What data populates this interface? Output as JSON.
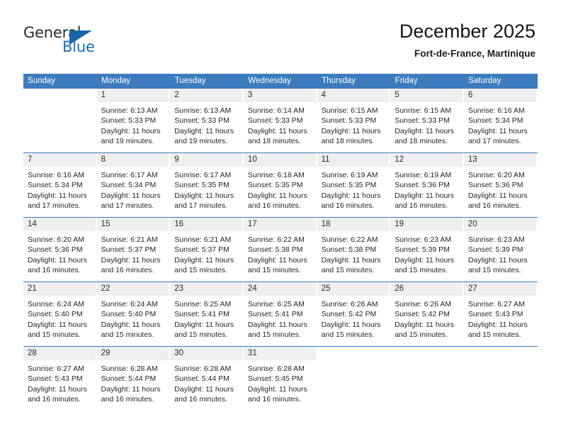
{
  "logo": {
    "word1": "General",
    "word2": "Blue",
    "triangle_color": "#1565a8",
    "blue_color": "#1c6fb8"
  },
  "header": {
    "title": "December 2025",
    "subtitle": "Fort-de-France, Martinique"
  },
  "theme": {
    "header_blue": "#3c7cbd",
    "daynum_gray": "#efefef",
    "text": "#262626"
  },
  "weekday_headers": [
    "Sunday",
    "Monday",
    "Tuesday",
    "Wednesday",
    "Thursday",
    "Friday",
    "Saturday"
  ],
  "weeks": [
    [
      {
        "day": "",
        "lines": []
      },
      {
        "day": "1",
        "lines": [
          "Sunrise: 6:13 AM",
          "Sunset: 5:33 PM",
          "Daylight: 11 hours",
          "and 19 minutes."
        ]
      },
      {
        "day": "2",
        "lines": [
          "Sunrise: 6:13 AM",
          "Sunset: 5:33 PM",
          "Daylight: 11 hours",
          "and 19 minutes."
        ]
      },
      {
        "day": "3",
        "lines": [
          "Sunrise: 6:14 AM",
          "Sunset: 5:33 PM",
          "Daylight: 11 hours",
          "and 18 minutes."
        ]
      },
      {
        "day": "4",
        "lines": [
          "Sunrise: 6:15 AM",
          "Sunset: 5:33 PM",
          "Daylight: 11 hours",
          "and 18 minutes."
        ]
      },
      {
        "day": "5",
        "lines": [
          "Sunrise: 6:15 AM",
          "Sunset: 5:33 PM",
          "Daylight: 11 hours",
          "and 18 minutes."
        ]
      },
      {
        "day": "6",
        "lines": [
          "Sunrise: 6:16 AM",
          "Sunset: 5:34 PM",
          "Daylight: 11 hours",
          "and 17 minutes."
        ]
      }
    ],
    [
      {
        "day": "7",
        "lines": [
          "Sunrise: 6:16 AM",
          "Sunset: 5:34 PM",
          "Daylight: 11 hours",
          "and 17 minutes."
        ]
      },
      {
        "day": "8",
        "lines": [
          "Sunrise: 6:17 AM",
          "Sunset: 5:34 PM",
          "Daylight: 11 hours",
          "and 17 minutes."
        ]
      },
      {
        "day": "9",
        "lines": [
          "Sunrise: 6:17 AM",
          "Sunset: 5:35 PM",
          "Daylight: 11 hours",
          "and 17 minutes."
        ]
      },
      {
        "day": "10",
        "lines": [
          "Sunrise: 6:18 AM",
          "Sunset: 5:35 PM",
          "Daylight: 11 hours",
          "and 16 minutes."
        ]
      },
      {
        "day": "11",
        "lines": [
          "Sunrise: 6:19 AM",
          "Sunset: 5:35 PM",
          "Daylight: 11 hours",
          "and 16 minutes."
        ]
      },
      {
        "day": "12",
        "lines": [
          "Sunrise: 6:19 AM",
          "Sunset: 5:36 PM",
          "Daylight: 11 hours",
          "and 16 minutes."
        ]
      },
      {
        "day": "13",
        "lines": [
          "Sunrise: 6:20 AM",
          "Sunset: 5:36 PM",
          "Daylight: 11 hours",
          "and 16 minutes."
        ]
      }
    ],
    [
      {
        "day": "14",
        "lines": [
          "Sunrise: 6:20 AM",
          "Sunset: 5:36 PM",
          "Daylight: 11 hours",
          "and 16 minutes."
        ]
      },
      {
        "day": "15",
        "lines": [
          "Sunrise: 6:21 AM",
          "Sunset: 5:37 PM",
          "Daylight: 11 hours",
          "and 16 minutes."
        ]
      },
      {
        "day": "16",
        "lines": [
          "Sunrise: 6:21 AM",
          "Sunset: 5:37 PM",
          "Daylight: 11 hours",
          "and 15 minutes."
        ]
      },
      {
        "day": "17",
        "lines": [
          "Sunrise: 6:22 AM",
          "Sunset: 5:38 PM",
          "Daylight: 11 hours",
          "and 15 minutes."
        ]
      },
      {
        "day": "18",
        "lines": [
          "Sunrise: 6:22 AM",
          "Sunset: 5:38 PM",
          "Daylight: 11 hours",
          "and 15 minutes."
        ]
      },
      {
        "day": "19",
        "lines": [
          "Sunrise: 6:23 AM",
          "Sunset: 5:39 PM",
          "Daylight: 11 hours",
          "and 15 minutes."
        ]
      },
      {
        "day": "20",
        "lines": [
          "Sunrise: 6:23 AM",
          "Sunset: 5:39 PM",
          "Daylight: 11 hours",
          "and 15 minutes."
        ]
      }
    ],
    [
      {
        "day": "21",
        "lines": [
          "Sunrise: 6:24 AM",
          "Sunset: 5:40 PM",
          "Daylight: 11 hours",
          "and 15 minutes."
        ]
      },
      {
        "day": "22",
        "lines": [
          "Sunrise: 6:24 AM",
          "Sunset: 5:40 PM",
          "Daylight: 11 hours",
          "and 15 minutes."
        ]
      },
      {
        "day": "23",
        "lines": [
          "Sunrise: 6:25 AM",
          "Sunset: 5:41 PM",
          "Daylight: 11 hours",
          "and 15 minutes."
        ]
      },
      {
        "day": "24",
        "lines": [
          "Sunrise: 6:25 AM",
          "Sunset: 5:41 PM",
          "Daylight: 11 hours",
          "and 15 minutes."
        ]
      },
      {
        "day": "25",
        "lines": [
          "Sunrise: 6:26 AM",
          "Sunset: 5:42 PM",
          "Daylight: 11 hours",
          "and 15 minutes."
        ]
      },
      {
        "day": "26",
        "lines": [
          "Sunrise: 6:26 AM",
          "Sunset: 5:42 PM",
          "Daylight: 11 hours",
          "and 15 minutes."
        ]
      },
      {
        "day": "27",
        "lines": [
          "Sunrise: 6:27 AM",
          "Sunset: 5:43 PM",
          "Daylight: 11 hours",
          "and 15 minutes."
        ]
      }
    ],
    [
      {
        "day": "28",
        "lines": [
          "Sunrise: 6:27 AM",
          "Sunset: 5:43 PM",
          "Daylight: 11 hours",
          "and 16 minutes."
        ]
      },
      {
        "day": "29",
        "lines": [
          "Sunrise: 6:28 AM",
          "Sunset: 5:44 PM",
          "Daylight: 11 hours",
          "and 16 minutes."
        ]
      },
      {
        "day": "30",
        "lines": [
          "Sunrise: 6:28 AM",
          "Sunset: 5:44 PM",
          "Daylight: 11 hours",
          "and 16 minutes."
        ]
      },
      {
        "day": "31",
        "lines": [
          "Sunrise: 6:28 AM",
          "Sunset: 5:45 PM",
          "Daylight: 11 hours",
          "and 16 minutes."
        ]
      },
      {
        "day": "",
        "lines": []
      },
      {
        "day": "",
        "lines": []
      },
      {
        "day": "",
        "lines": []
      }
    ]
  ]
}
